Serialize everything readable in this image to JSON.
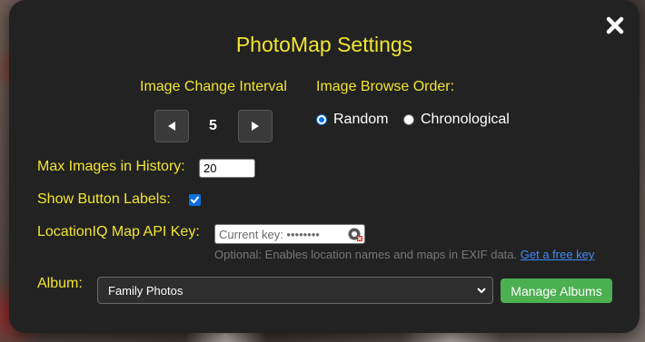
{
  "dialog": {
    "title": "PhotoMap Settings"
  },
  "interval": {
    "label": "Image Change Interval",
    "value": "5"
  },
  "browse_order": {
    "label": "Image Browse Order:",
    "options": [
      {
        "label": "Random",
        "selected": true
      },
      {
        "label": "Chronological",
        "selected": false
      }
    ]
  },
  "history": {
    "label": "Max Images in History:",
    "value": "20"
  },
  "button_labels": {
    "label": "Show Button Labels:",
    "checked": true
  },
  "locationiq": {
    "label": "LocationIQ Map API Key:",
    "placeholder": "Current key: ••••••••",
    "hint": "Optional: Enables location names and maps in EXIF data.",
    "link": "Get a free key"
  },
  "album": {
    "label": "Album:",
    "selected": "Family Photos",
    "manage_label": "Manage Albums"
  },
  "colors": {
    "accent_yellow": "#f2e531",
    "modal_bg": "#222222",
    "manage_green": "#4caf50",
    "link_blue": "#3d8bfd"
  },
  "icons": [
    "close-icon",
    "arrow-left-icon",
    "arrow-right-icon",
    "password-toggle-icon",
    "chevron-down-icon"
  ]
}
